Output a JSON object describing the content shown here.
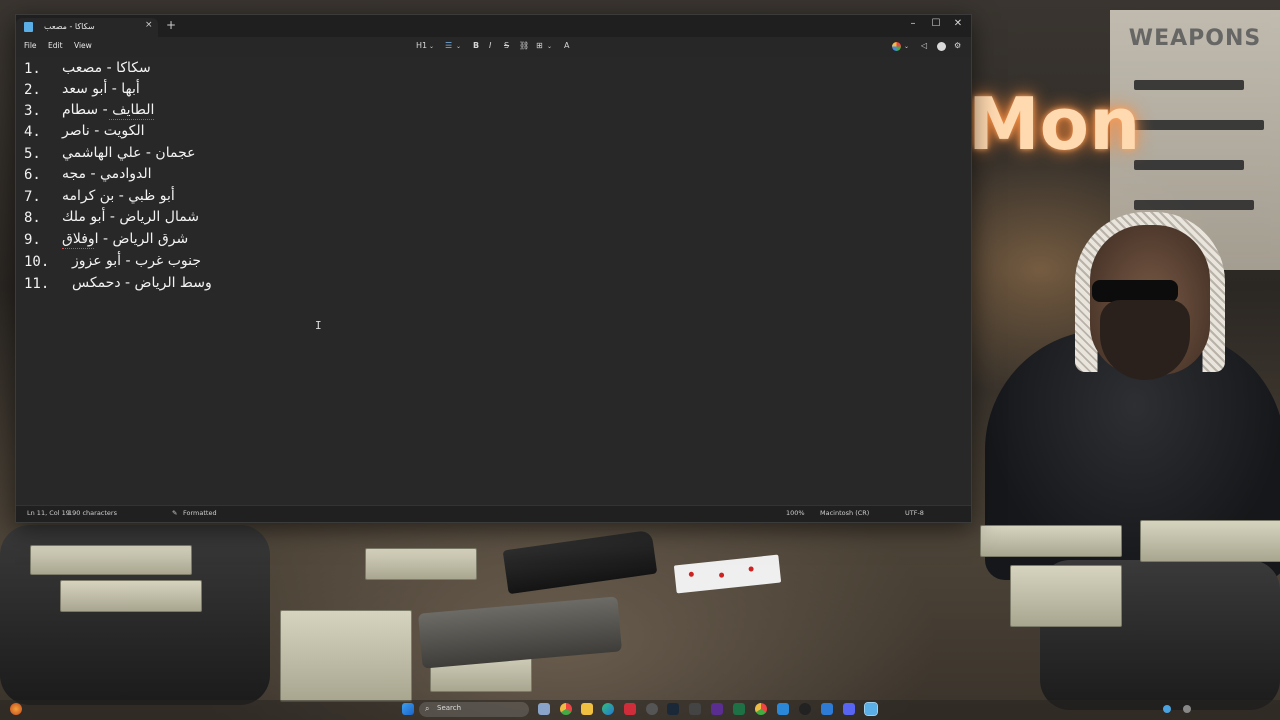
{
  "window": {
    "tab_title": "سكاكا - مصعب",
    "close_tab": "×",
    "new_tab": "+",
    "minimize": "–",
    "maximize": "☐",
    "close": "✕"
  },
  "menu": {
    "file": "File",
    "edit": "Edit",
    "view": "View"
  },
  "toolbar": {
    "heading": "H1",
    "list": "☰",
    "bold": "B",
    "italic": "I",
    "strike": "S",
    "link": "⛓",
    "table": "⊞",
    "clear_format": "A"
  },
  "lines": [
    {
      "num": "1.",
      "text": "سكاكا - مصعب"
    },
    {
      "num": "2.",
      "text": "أبها - أبو سعد"
    },
    {
      "num": "3.",
      "text": "الطايف - سطام"
    },
    {
      "num": "4.",
      "text": "الكويت - ناصر"
    },
    {
      "num": "5.",
      "text": "عجمان - علي الهاشمي"
    },
    {
      "num": "6.",
      "text": "الدوادمي - مجه"
    },
    {
      "num": "7.",
      "text": "أبو ظبي - بن كرامه"
    },
    {
      "num": "8.",
      "text": "شمال الرياض - أبو ملك"
    },
    {
      "num": "9.",
      "text": "شرق الرياض - اوفلاق"
    },
    {
      "num": "10.",
      "text": "جنوب غرب - أبو عزوز"
    },
    {
      "num": "11.",
      "text": "وسط الرياض - دحمكس"
    }
  ],
  "status": {
    "position": "Ln 11, Col 19",
    "chars": "190 characters",
    "format": "Formatted",
    "zoom": "100%",
    "line_ending": "Macintosh (CR)",
    "encoding": "UTF-8"
  },
  "wallpaper": {
    "poster_title": "WEAPONS",
    "neon": "Mon"
  },
  "taskbar": {
    "search_placeholder": "Search"
  },
  "colors": {
    "editor_bg": "#282828",
    "titlebar_bg": "#1f1f1f",
    "text": "#f2f2f2",
    "spell_error": "#d24a4a",
    "accent": "#5ab0e6"
  }
}
